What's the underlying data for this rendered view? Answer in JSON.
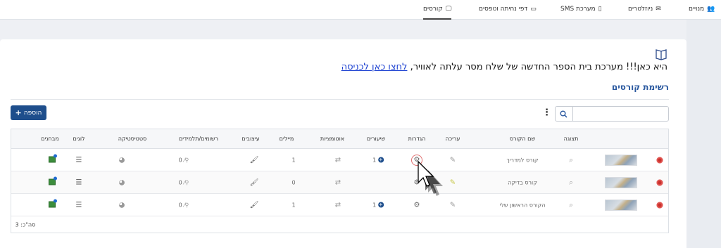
{
  "nav": {
    "items": [
      {
        "label": "מנויים",
        "icon": "users-icon"
      },
      {
        "label": "ניוזלטרים",
        "icon": "envelope-icon"
      },
      {
        "label": "מערכת SMS",
        "icon": "mobile-icon"
      },
      {
        "label": "דפי נחיתה וטפסים",
        "icon": "landing-page-icon"
      },
      {
        "label": "קורסים",
        "icon": "monitor-icon"
      }
    ],
    "active": "קורסים"
  },
  "announcement": {
    "text": "היא כאן!!! מערכת בית הספר החדשה של שלח מסר עלתה לאוויר,",
    "link": "לחצו כאן לכניסה"
  },
  "section_title": "רשימת קורסים",
  "toolbar": {
    "search_placeholder": "",
    "add_label": "הוספה"
  },
  "table": {
    "headers": {
      "preview": "תצוגה",
      "name": "שם הקורס",
      "edit": "עריכה",
      "settings": "הגדרות",
      "lessons": "שיעורים",
      "automations": "אוטומציות",
      "emails": "מיילים",
      "designs": "עיצובים",
      "registrants": "רשומים/תלמידים",
      "statistics": "סטטיסטיקה",
      "logs": "לוגים",
      "exams": "מבחנים"
    },
    "rows": [
      {
        "name": "קורס למדריך",
        "lessons": "1",
        "emails": "1",
        "registrants": "0"
      },
      {
        "name": "קורס בדיקה",
        "lessons": "",
        "emails": "0",
        "registrants": "0"
      },
      {
        "name": "הקורס הראשון שלי",
        "lessons": "1",
        "emails": "1",
        "registrants": "0"
      }
    ],
    "footer": "סה\"כ: 3"
  }
}
